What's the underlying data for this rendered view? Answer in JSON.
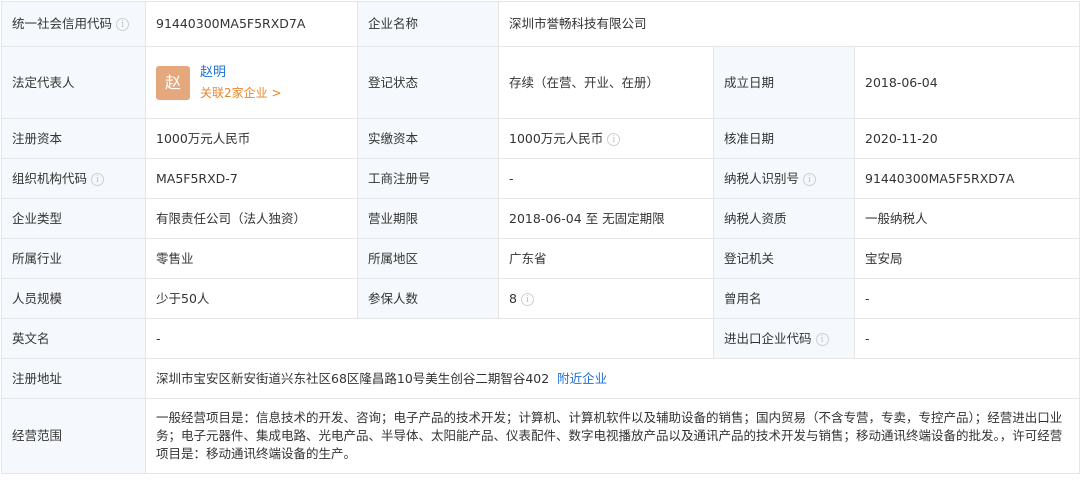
{
  "rows": {
    "credit_code": {
      "label": "统一社会信用代码",
      "value": "91440300MA5F5RXD7A"
    },
    "company_name": {
      "label": "企业名称",
      "value": "深圳市誉畅科技有限公司"
    },
    "legal_rep": {
      "label": "法定代表人",
      "avatar_char": "赵",
      "name": "赵明",
      "related": "关联2家企业 >"
    },
    "reg_status": {
      "label": "登记状态",
      "value": "存续（在营、开业、在册）"
    },
    "founded": {
      "label": "成立日期",
      "value": "2018-06-04"
    },
    "reg_capital": {
      "label": "注册资本",
      "value": "1000万元人民币"
    },
    "paid_capital": {
      "label": "实缴资本",
      "value": "1000万元人民币"
    },
    "approval_date": {
      "label": "核准日期",
      "value": "2020-11-20"
    },
    "org_code": {
      "label": "组织机构代码",
      "value": "MA5F5RXD-7"
    },
    "biz_reg_no": {
      "label": "工商注册号",
      "value": "-"
    },
    "taxpayer_id": {
      "label": "纳税人识别号",
      "value": "91440300MA5F5RXD7A"
    },
    "company_type": {
      "label": "企业类型",
      "value": "有限责任公司（法人独资）"
    },
    "biz_term": {
      "label": "营业期限",
      "value": "2018-06-04 至 无固定期限"
    },
    "taxpayer_qual": {
      "label": "纳税人资质",
      "value": "一般纳税人"
    },
    "industry": {
      "label": "所属行业",
      "value": "零售业"
    },
    "region": {
      "label": "所属地区",
      "value": "广东省"
    },
    "reg_authority": {
      "label": "登记机关",
      "value": "宝安局"
    },
    "staff_size": {
      "label": "人员规模",
      "value": "少于50人"
    },
    "insured": {
      "label": "参保人数",
      "value": "8"
    },
    "former_name": {
      "label": "曾用名",
      "value": "-"
    },
    "english_name": {
      "label": "英文名",
      "value": "-"
    },
    "import_export_code": {
      "label": "进出口企业代码",
      "value": "-"
    },
    "address": {
      "label": "注册地址",
      "value": "深圳市宝安区新安街道兴东社区68区隆昌路10号美生创谷二期智谷402",
      "link": "附近企业"
    },
    "scope": {
      "label": "经营范围",
      "value": "一般经营项目是：信息技术的开发、咨询；电子产品的技术开发；计算机、计算机软件以及辅助设备的销售；国内贸易（不含专营，专卖，专控产品）；经营进出口业务；电子元器件、集成电路、光电产品、半导体、太阳能产品、仪表配件、数字电视播放产品以及通讯产品的技术开发与销售；移动通讯终端设备的批发。，许可经营项目是：移动通讯终端设备的生产。"
    }
  },
  "icons": {
    "info": "info-circle-icon"
  },
  "colors": {
    "label_bg": "#f5f8fc",
    "border": "#e6e6e6",
    "link": "#1e6fd6",
    "orange": "#e8862c",
    "avatar_bg": "#e5a77c"
  }
}
